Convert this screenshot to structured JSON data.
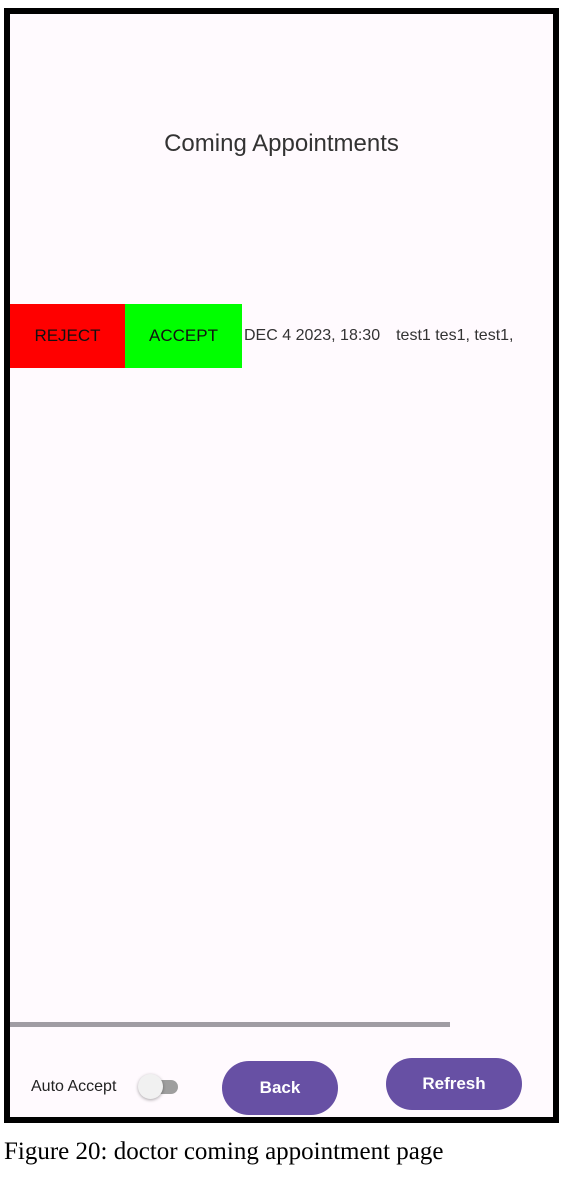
{
  "screen": {
    "title": "Coming Appointments"
  },
  "appointments": [
    {
      "reject_label": "REJECT",
      "accept_label": "ACCEPT",
      "datetime": "DEC 4 2023, 18:30",
      "patient": "test1 tes1, test1,"
    }
  ],
  "bottom_bar": {
    "auto_accept_label": "Auto Accept",
    "auto_accept_on": false,
    "back_label": "Back",
    "refresh_label": "Refresh"
  },
  "caption": "Figure 20: doctor coming appointment page",
  "colors": {
    "reject": "#ff0000",
    "accept": "#00ff00",
    "primary": "#6750a4",
    "background": "#fffafe"
  }
}
